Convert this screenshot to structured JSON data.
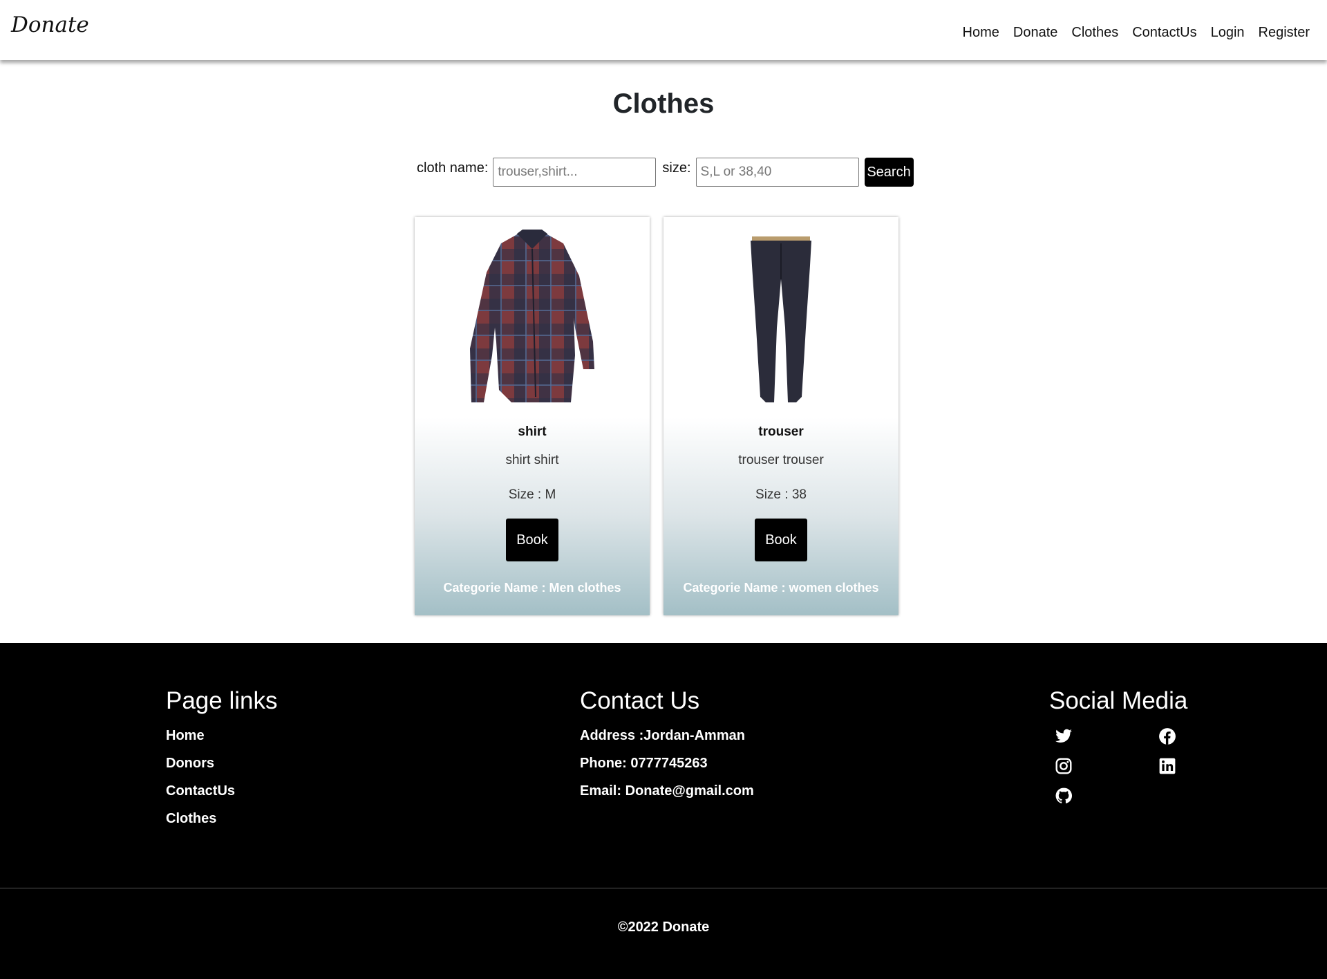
{
  "navbar": {
    "brand": "Donate",
    "links": [
      "Home",
      "Donate",
      "Clothes",
      "ContactUs",
      "Login",
      "Register"
    ]
  },
  "page": {
    "title": "Clothes"
  },
  "search": {
    "cloth_label": "cloth name:",
    "cloth_placeholder": "trouser,shirt...",
    "size_label": "size:",
    "size_placeholder": "S,L or 38,40",
    "button": "Search"
  },
  "cards": [
    {
      "name": "shirt",
      "description": "shirt shirt",
      "size": "Size : M",
      "button": "Book",
      "category": "Categorie Name : Men clothes",
      "image_icon": "plaid-shirt-image"
    },
    {
      "name": "trouser",
      "description": "trouser trouser",
      "size": "Size : 38",
      "button": "Book",
      "category": "Categorie Name : women clothes",
      "image_icon": "trouser-image"
    }
  ],
  "footer": {
    "links_title": "Page links",
    "links": [
      "Home",
      "Donors",
      "ContactUs",
      "Clothes"
    ],
    "contact_title": "Contact Us",
    "address": "Address :Jordan-Amman",
    "phone": "Phone: 0777745263",
    "email": "Email: Donate@gmail.com",
    "social_title": "Social Media",
    "social_icons": [
      "twitter-icon",
      "facebook-icon",
      "instagram-icon",
      "linkedin-icon",
      "github-icon"
    ],
    "copyright": "©2022 Donate"
  },
  "colors": {
    "button_bg": "#000000",
    "card_gradient_bottom": "#a3bfc6",
    "footer_bg": "#000000"
  }
}
